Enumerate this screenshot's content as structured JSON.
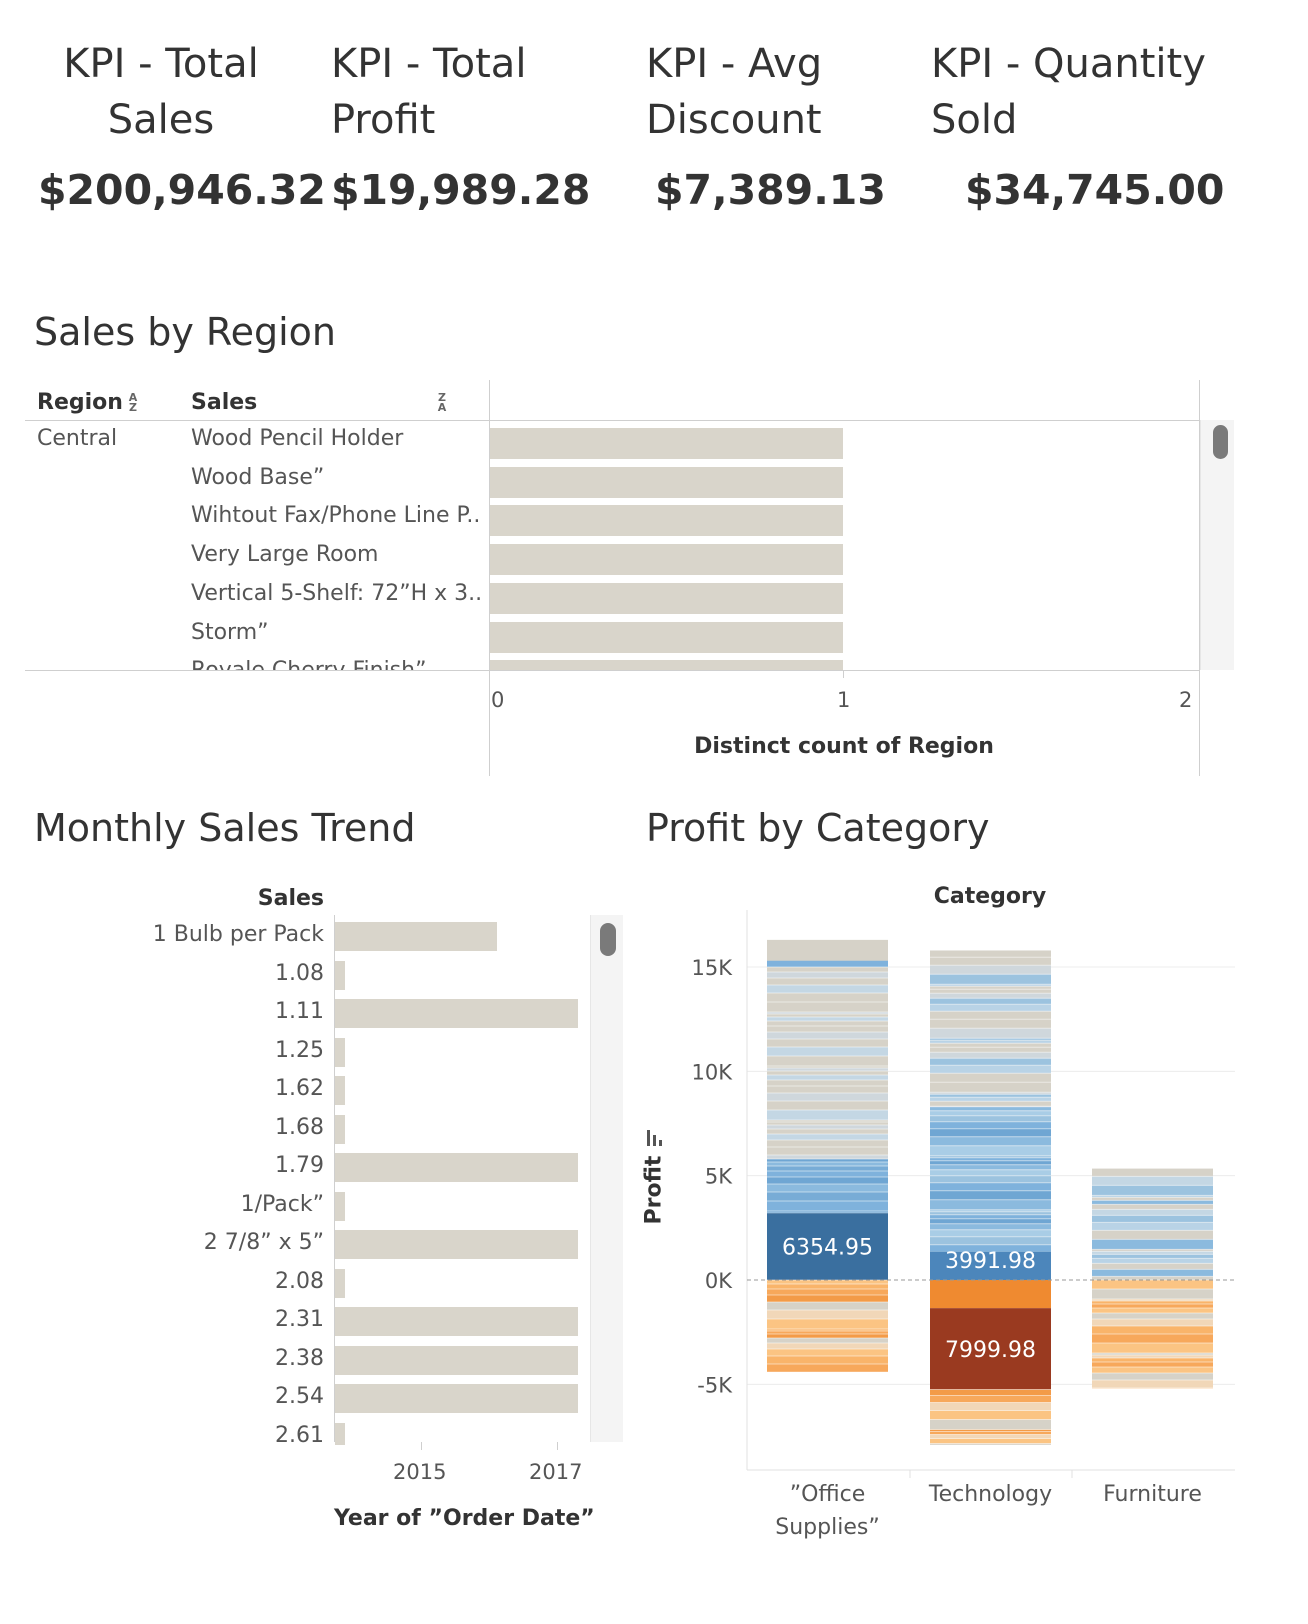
{
  "kpis": [
    {
      "title_line1": "KPI - Total",
      "title_line2": "Sales",
      "value": "$200,946.32"
    },
    {
      "title_line1": "KPI - Total",
      "title_line2": "Profit",
      "value": "$19,989.28"
    },
    {
      "title_line1": "KPI - Avg",
      "title_line2": "Discount",
      "value": "$7,389.13"
    },
    {
      "title_line1": "KPI - Quantity",
      "title_line2": "Sold",
      "value": "$34,745.00"
    }
  ],
  "colors": {
    "bar": "#d9d5cb",
    "grid": "#e9e9e9",
    "text": "#333333",
    "scroll_thumb": "#7a7a7a"
  },
  "chart_data": [
    {
      "title": "Sales by Region",
      "type": "bar",
      "orientation": "horizontal",
      "column_headers": {
        "region": "Region",
        "sales": "Sales"
      },
      "region": "Central",
      "categories": [
        "Wood Pencil Holder",
        "Wood Base”",
        "Wihtout Fax/Phone Line P..",
        "Very Large Room",
        "Vertical 5-Shelf: 72”H x 3..",
        "Storm”",
        "Royale Cherry Finish”"
      ],
      "values": [
        1,
        1,
        1,
        1,
        1,
        1,
        1
      ],
      "xlabel": "Distinct count of Region",
      "xlim": [
        0,
        2
      ],
      "ticks": [
        "0",
        "1",
        "2"
      ],
      "scrollbar": true
    },
    {
      "title": "Monthly Sales Trend",
      "type": "bar",
      "orientation": "horizontal",
      "column_header": "Sales",
      "categories": [
        "1 Bulb per Pack",
        "1.08",
        "1.11",
        "1.25",
        "1.62",
        "1.68",
        "1.79",
        "1/Pack”",
        "2 7/8” x 5”",
        "2.08",
        "2.31",
        "2.38",
        "2.54",
        "2.61"
      ],
      "values_start": [
        2014.0,
        2014.0,
        2014.0,
        2014.0,
        2014.0,
        2014.0,
        2014.0,
        2014.0,
        2014.0,
        2014.0,
        2014.0,
        2014.0,
        2014.0,
        2014.0
      ],
      "values_end": [
        2016.0,
        2014.1,
        2017.0,
        2014.1,
        2014.1,
        2014.1,
        2017.0,
        2014.1,
        2017.0,
        2014.1,
        2017.0,
        2017.0,
        2017.0,
        2014.1
      ],
      "xlabel": "Year of ”Order Date”",
      "ticks": [
        "2015",
        "2017"
      ],
      "scrollbar": true
    },
    {
      "title": "Profit by Category",
      "type": "bar",
      "stacked": true,
      "column_header": "Category",
      "categories": [
        "”Office Supplies”",
        "Technology",
        "Furniture"
      ],
      "ylabel": "Profit",
      "ylim": [
        -8000,
        16500
      ],
      "yticks": [
        "15K",
        "10K",
        "5K",
        "0K",
        "-5K"
      ],
      "series": [
        {
          "category": "”Office Supplies”",
          "positive_total": 16300,
          "negative_total": -4400,
          "highlight_segment": {
            "label": "6354.95",
            "from": 0,
            "to": 3200
          }
        },
        {
          "category": "Technology",
          "positive_total": 15800,
          "negative_total": -7900,
          "highlight_segment": {
            "label": "3991.98",
            "from": 0,
            "to": 1350
          }
        },
        {
          "category": "Technology",
          "positive_total": 15800,
          "negative_total": -7900,
          "highlight_segment": {
            "label": "7999.98",
            "from": -1350,
            "to": -5250
          }
        },
        {
          "category": "Furniture",
          "positive_total": 5350,
          "negative_total": -5200
        }
      ]
    }
  ]
}
